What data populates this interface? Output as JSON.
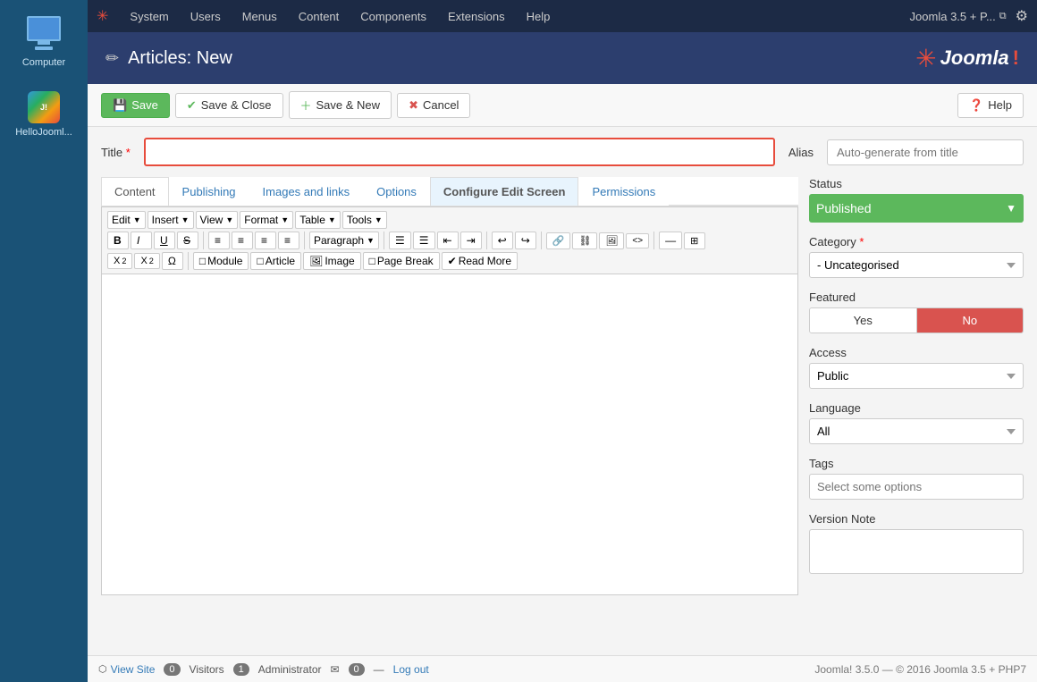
{
  "sidebar": {
    "computer_label": "Computer",
    "hellojoomla_label": "HelloJooml..."
  },
  "topnav": {
    "logo_symbol": "✳",
    "items": [
      {
        "label": "System"
      },
      {
        "label": "Users"
      },
      {
        "label": "Menus"
      },
      {
        "label": "Content"
      },
      {
        "label": "Components"
      },
      {
        "label": "Extensions"
      },
      {
        "label": "Help"
      }
    ],
    "right_user": "Joomla 3.5 + P...",
    "right_link_icon": "⧉",
    "gear_icon": "⚙"
  },
  "header": {
    "edit_icon": "✏",
    "title": "Articles: New",
    "brand_star": "✳",
    "brand_text": "Joomla",
    "brand_exclaim": "!"
  },
  "toolbar": {
    "save_label": "Save",
    "save_close_label": "Save & Close",
    "save_new_label": "Save & New",
    "cancel_label": "Cancel",
    "help_label": "Help"
  },
  "form": {
    "title_label": "Title",
    "title_placeholder": "",
    "alias_label": "Alias",
    "alias_placeholder": "Auto-generate from title"
  },
  "tabs": [
    {
      "label": "Content",
      "active": true
    },
    {
      "label": "Publishing"
    },
    {
      "label": "Images and links"
    },
    {
      "label": "Options"
    },
    {
      "label": "Configure Edit Screen",
      "highlighted": true
    },
    {
      "label": "Permissions"
    }
  ],
  "editor": {
    "menus": [
      {
        "label": "Edit",
        "has_caret": true
      },
      {
        "label": "Insert",
        "has_caret": true
      },
      {
        "label": "View",
        "has_caret": true
      },
      {
        "label": "Format",
        "has_caret": true
      },
      {
        "label": "Table",
        "has_caret": true
      },
      {
        "label": "Tools",
        "has_caret": true
      }
    ],
    "toolbar_row1": {
      "bold": "B",
      "italic": "I",
      "underline": "U",
      "strikethrough": "S",
      "align_left": "≡",
      "align_center": "≡",
      "align_right": "≡",
      "align_justify": "≡",
      "paragraph_label": "Paragraph",
      "ul": "☰",
      "ol": "☰",
      "outdent": "⇤",
      "indent": "⇥",
      "undo": "↩",
      "redo": "↪",
      "link": "🔗",
      "unlink": "⛓",
      "image": "🖼",
      "code": "<>",
      "hr": "—",
      "table": "⊞"
    },
    "toolbar_row2": {
      "subscript": "X₂",
      "superscript": "X²",
      "special_char": "Ω",
      "module_label": "Module",
      "article_label": "Article",
      "image_label": "Image",
      "page_break_label": "Page Break",
      "read_more_label": "Read More"
    }
  },
  "right_panel": {
    "status_label": "Status",
    "status_value": "Published",
    "category_label": "Category",
    "category_required": true,
    "category_options": [
      "- Uncategorised"
    ],
    "category_selected": "- Uncategorised",
    "featured_label": "Featured",
    "featured_yes": "Yes",
    "featured_no": "No",
    "access_label": "Access",
    "access_options": [
      "Public"
    ],
    "access_selected": "Public",
    "language_label": "Language",
    "language_options": [
      "All"
    ],
    "language_selected": "All",
    "tags_label": "Tags",
    "tags_placeholder": "Select some options",
    "version_note_label": "Version Note",
    "version_note_value": ""
  },
  "statusbar": {
    "view_site_label": "View Site",
    "visitors_label": "Visitors",
    "visitors_count": "0",
    "admin_label": "Administrator",
    "admin_count": "1",
    "email_icon": "✉",
    "logout_icon": "—",
    "logout_label": "Log out",
    "version_info": "Joomla! 3.5.0 — © 2016 Joomla 3.5 + PHP7"
  }
}
